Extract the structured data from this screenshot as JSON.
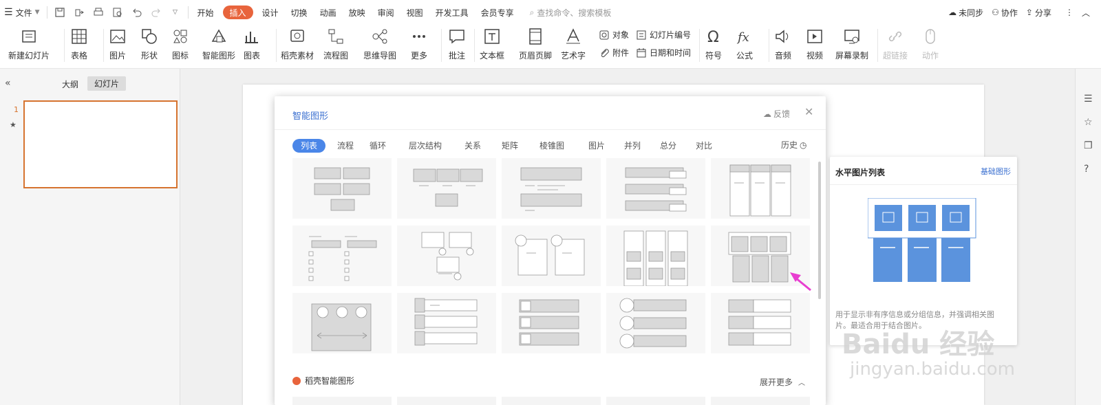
{
  "topbar": {
    "file_menu": "文件",
    "tabs": [
      {
        "label": "开始"
      },
      {
        "label": "插入"
      },
      {
        "label": "设计"
      },
      {
        "label": "切换"
      },
      {
        "label": "动画"
      },
      {
        "label": "放映"
      },
      {
        "label": "审阅"
      },
      {
        "label": "视图"
      },
      {
        "label": "开发工具"
      },
      {
        "label": "会员专享"
      }
    ],
    "search_placeholder": "查找命令、搜索模板",
    "sync_label": "未同步",
    "collab_label": "协作",
    "share_label": "分享"
  },
  "ribbon": {
    "new_slide": "新建幻灯片",
    "table": "表格",
    "picture": "图片",
    "shape": "形状",
    "icon": "图标",
    "smartart": "智能图形",
    "chart": "图表",
    "material": "稻壳素材",
    "flowchart": "流程图",
    "mindmap": "思维导图",
    "more": "更多",
    "comment": "批注",
    "textbox": "文本框",
    "header_footer": "页眉页脚",
    "wordart": "艺术字",
    "object": "对象",
    "attachment": "附件",
    "slide_number": "幻灯片编号",
    "datetime": "日期和时间",
    "symbol": "符号",
    "formula": "公式",
    "audio": "音频",
    "video": "视频",
    "screen_record": "屏幕录制",
    "hyperlink": "超链接",
    "action": "动作"
  },
  "left_panel": {
    "tab_outline": "大纲",
    "tab_slides": "幻灯片",
    "slide_number": "1"
  },
  "dialog": {
    "title": "智能图形",
    "feedback": "反馈",
    "categories": [
      {
        "label": "列表"
      },
      {
        "label": "流程"
      },
      {
        "label": "循环"
      },
      {
        "label": "层次结构"
      },
      {
        "label": "关系"
      },
      {
        "label": "矩阵"
      },
      {
        "label": "棱锥图"
      },
      {
        "label": "图片"
      },
      {
        "label": "并列"
      },
      {
        "label": "总分"
      },
      {
        "label": "对比"
      }
    ],
    "history": "历史",
    "section_title": "稻壳智能图形",
    "expand_more": "展开更多"
  },
  "preview": {
    "title": "水平图片列表",
    "basic_link": "基础图形",
    "desc_line1": "用于显示非有序信息或分组信息，并强调相关图",
    "desc_line2": "片。最适合用于结合图片。"
  },
  "watermark": {
    "logo": "Baidu 经验",
    "url": "jingyan.baidu.com"
  },
  "colors": {
    "accent": "#e8643c",
    "blue": "#4a86e8",
    "thumbnail_border": "#d6732e",
    "preview_fill": "#5b93dd",
    "arrow": "#e83ed0"
  }
}
